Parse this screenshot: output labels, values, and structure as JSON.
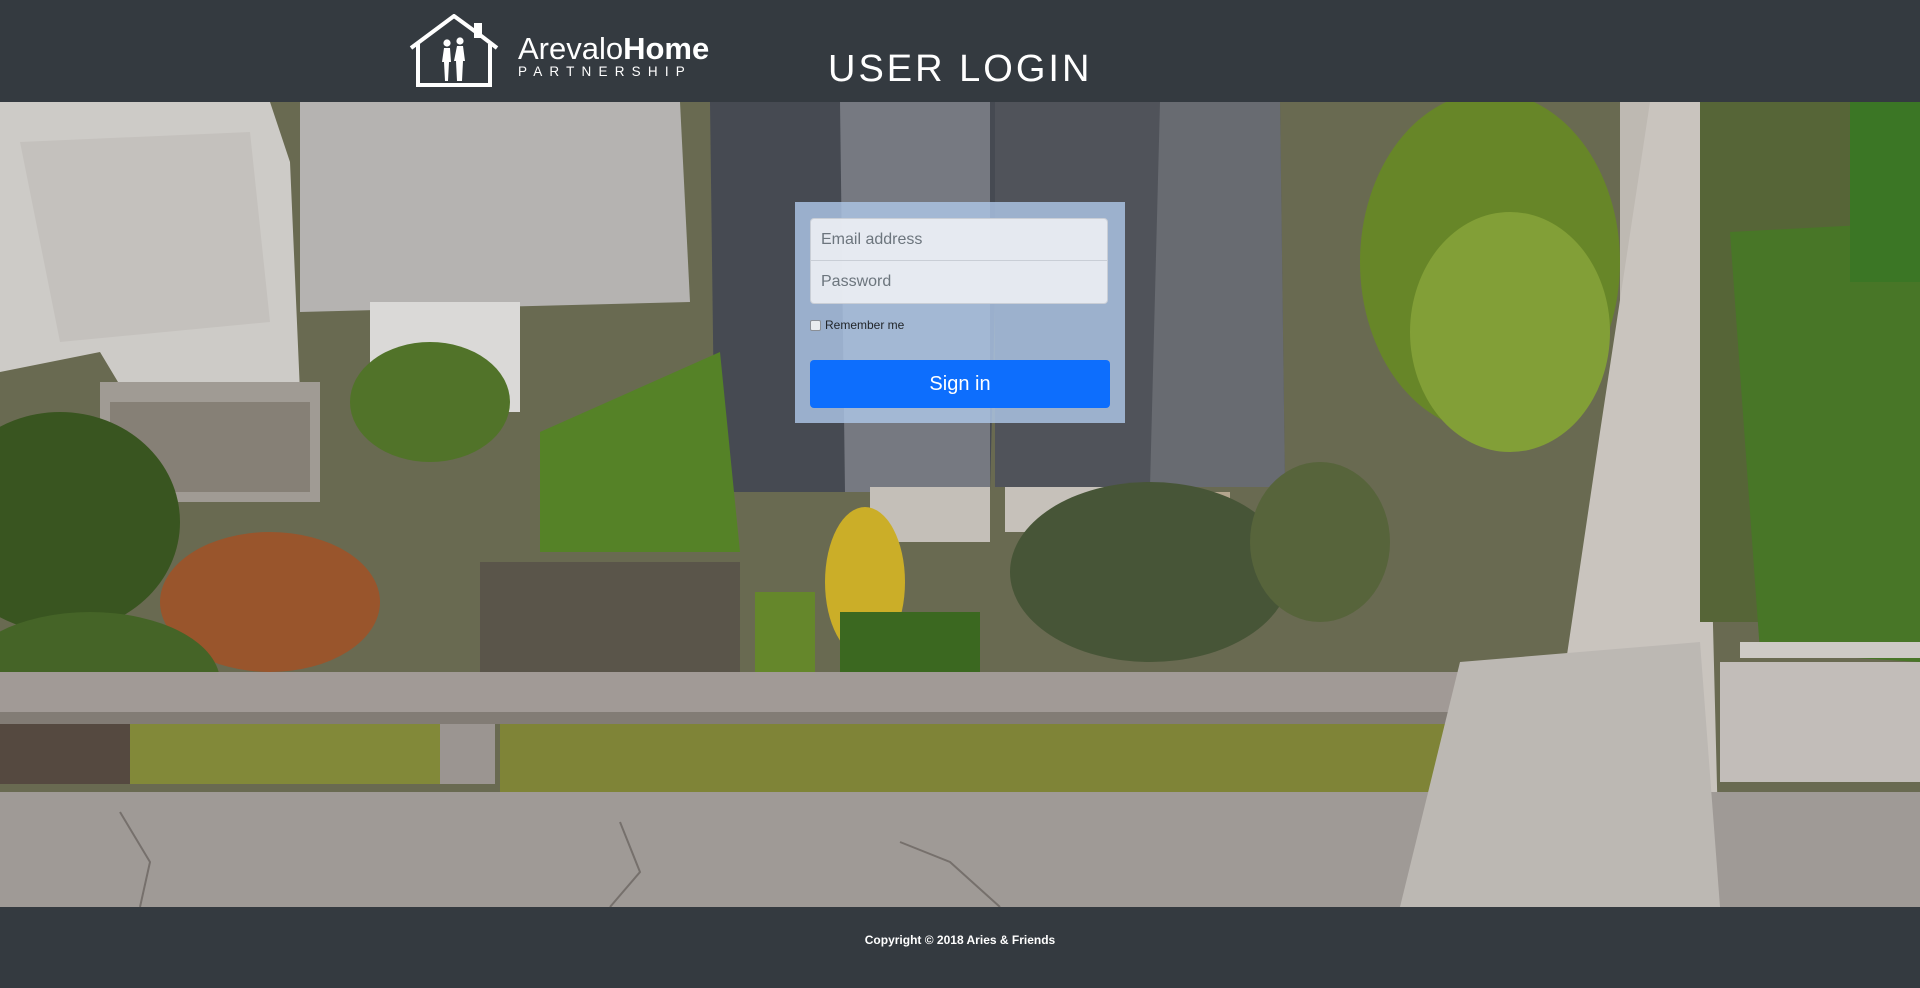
{
  "header": {
    "logo": {
      "name_light": "Arevalo",
      "name_bold": "Home",
      "tagline": "PARTNERSHIP"
    },
    "title": "USER LOGIN"
  },
  "login": {
    "email_placeholder": "Email address",
    "password_placeholder": "Password",
    "remember_label": "Remember me",
    "remember_checked": false,
    "signin_label": "Sign in"
  },
  "footer": {
    "copyright": "Copyright © 2018 Aries & Friends"
  },
  "colors": {
    "bar": "#343a40",
    "primary_button": "#0d6efd",
    "login_panel": "#adc6e6"
  },
  "icons": [
    "house-logo-icon"
  ]
}
